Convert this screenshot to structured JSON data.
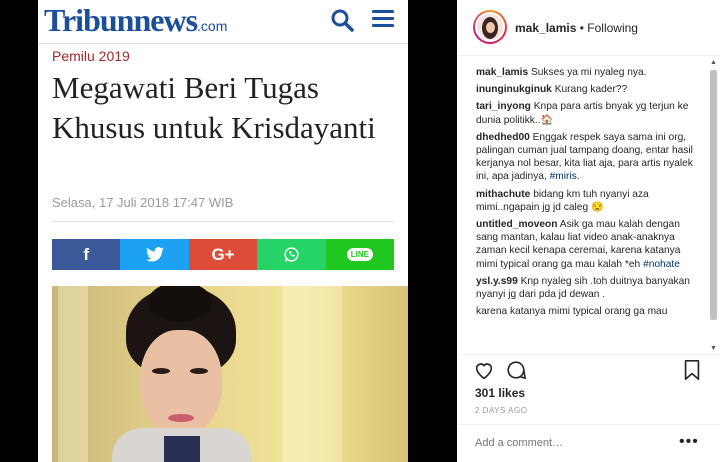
{
  "article": {
    "logo_main": "Tribunnews",
    "logo_suffix": ".com",
    "category": "Pemilu 2019",
    "headline": "Megawati Beri Tugas Khusus untuk Krisdayanti",
    "date": "Selasa, 17 Juli 2018 17:47 WIB",
    "share": {
      "facebook": "f",
      "twitter": "twitter-bird-icon",
      "googleplus": "G+",
      "whatsapp": "whatsapp-icon",
      "line": "LINE"
    },
    "colors": {
      "brand": "#1b4e9b",
      "category": "#a22a2a",
      "facebook": "#3b5998",
      "twitter": "#1da1f2",
      "googleplus": "#dd4b39",
      "whatsapp": "#25d366",
      "line": "#1fc71f"
    }
  },
  "instagram": {
    "username": "mak_lamis",
    "separator": "•",
    "follow_status": "Following",
    "comments": [
      {
        "user": "mak_lamis",
        "text": "Sukses ya mi nyaleg nya."
      },
      {
        "user": "inunginukginuk",
        "text": "Kurang kader??"
      },
      {
        "user": "tari_inyong",
        "text": "Knpa para artis bnyak yg terjun ke dunia politikk..🏠"
      },
      {
        "user": "dhedhed00",
        "text": "Enggak respek saya sama ini org, palingan cuman jual tampang doang, entar hasil kerjanya nol besar, kita liat aja, para artis nyalek ini, apa jadinya,",
        "tag": "#miris",
        "after": "."
      },
      {
        "user": "mithachute",
        "text": "bidang km tuh nyanyi aza mimi..ngapain jg jd caleg 😒"
      },
      {
        "user": "untitled_moveon",
        "text": "Asik ga mau kalah dengan sang mantan, kalau liat video anak-anaknya zaman kecil kenapa ceremai, karena katanya mimi typical orang ga mau kalah *eh",
        "tag": "#nohate",
        "after": ""
      },
      {
        "user": "ysl.y.s99",
        "text": "Knp nyaleg sih .toh duitnya banyakan nyanyi jg dari pda jd dewan ."
      },
      {
        "user": "",
        "text": "karena katanya mimi typical orang ga mau"
      }
    ],
    "likes": "301 likes",
    "time_ago": "2 DAYS AGO",
    "add_comment_placeholder": "Add a comment…",
    "more_label": "•••"
  }
}
